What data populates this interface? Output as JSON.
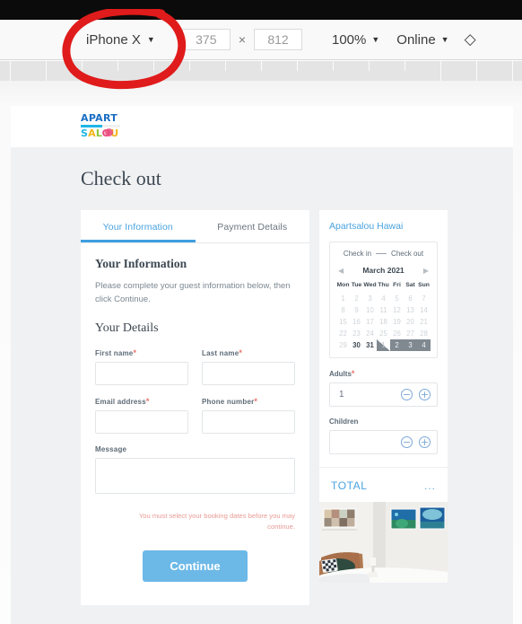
{
  "devtools": {
    "device": "iPhone X",
    "width": "375",
    "height": "812",
    "dim_separator": "×",
    "zoom": "100%",
    "throttling": "Online",
    "more_icon": "more-options-icon",
    "caret_icon": "▼"
  },
  "site": {
    "logo_top": "APART",
    "logo_bottom": [
      "S",
      "A",
      "L",
      "O",
      "U"
    ]
  },
  "page": {
    "title": "Check out"
  },
  "tabs": [
    {
      "label": "Your Information",
      "active": true
    },
    {
      "label": "Payment Details",
      "active": false
    }
  ],
  "form": {
    "heading": "Your Information",
    "lead": "Please complete your guest information below, then click Continue.",
    "subheading": "Your Details",
    "fields": [
      {
        "label": "First name",
        "required": true,
        "value": "",
        "name": "first-name"
      },
      {
        "label": "Last name",
        "required": true,
        "value": "",
        "name": "last-name"
      },
      {
        "label": "Email address",
        "required": true,
        "value": "",
        "name": "email-address"
      },
      {
        "label": "Phone number",
        "required": true,
        "value": "",
        "name": "phone-number"
      }
    ],
    "message_label": "Message",
    "message_value": "",
    "error": "You must select your booking dates before you may continue.",
    "continue_label": "Continue"
  },
  "booking": {
    "property": "Apartsalou Hawai",
    "check_in_label": "Check in",
    "check_out_label": "Check out",
    "month": "March 2021",
    "prev_icon": "◀",
    "next_icon": "▶",
    "weekdays": [
      "Mon",
      "Tue",
      "Wed",
      "Thu",
      "Fri",
      "Sat",
      "Sun"
    ],
    "weeks": [
      [
        {
          "d": "1",
          "s": "past"
        },
        {
          "d": "2",
          "s": "past"
        },
        {
          "d": "3",
          "s": "past"
        },
        {
          "d": "4",
          "s": "past"
        },
        {
          "d": "5",
          "s": "past"
        },
        {
          "d": "6",
          "s": "past"
        },
        {
          "d": "7",
          "s": "past"
        }
      ],
      [
        {
          "d": "8",
          "s": "past"
        },
        {
          "d": "9",
          "s": "past"
        },
        {
          "d": "10",
          "s": "past"
        },
        {
          "d": "11",
          "s": "past"
        },
        {
          "d": "12",
          "s": "past"
        },
        {
          "d": "13",
          "s": "past"
        },
        {
          "d": "14",
          "s": "past"
        }
      ],
      [
        {
          "d": "15",
          "s": "past"
        },
        {
          "d": "16",
          "s": "past"
        },
        {
          "d": "17",
          "s": "past"
        },
        {
          "d": "18",
          "s": "past"
        },
        {
          "d": "19",
          "s": "past"
        },
        {
          "d": "20",
          "s": "past"
        },
        {
          "d": "21",
          "s": "past"
        }
      ],
      [
        {
          "d": "22",
          "s": "past"
        },
        {
          "d": "23",
          "s": "past"
        },
        {
          "d": "24",
          "s": "past"
        },
        {
          "d": "25",
          "s": "past"
        },
        {
          "d": "26",
          "s": "past"
        },
        {
          "d": "27",
          "s": "past"
        },
        {
          "d": "28",
          "s": "past"
        }
      ],
      [
        {
          "d": "29",
          "s": "past"
        },
        {
          "d": "30",
          "s": "cur"
        },
        {
          "d": "31",
          "s": "cur"
        },
        {
          "d": "1",
          "s": "next-start"
        },
        {
          "d": "2",
          "s": "next"
        },
        {
          "d": "3",
          "s": "next"
        },
        {
          "d": "4",
          "s": "next"
        }
      ]
    ],
    "adults_label": "Adults",
    "adults_required": true,
    "adults_value": "1",
    "children_label": "Children",
    "children_value": "",
    "minus_icon": "−",
    "plus_icon": "+",
    "total_label": "TOTAL",
    "total_value": "...",
    "photo_alt": "apartment-bedroom-photo"
  },
  "annotation": {
    "shape": "red-hand-drawn-circle",
    "color": "#e01b1b",
    "targets": "iPhone X device selector"
  }
}
